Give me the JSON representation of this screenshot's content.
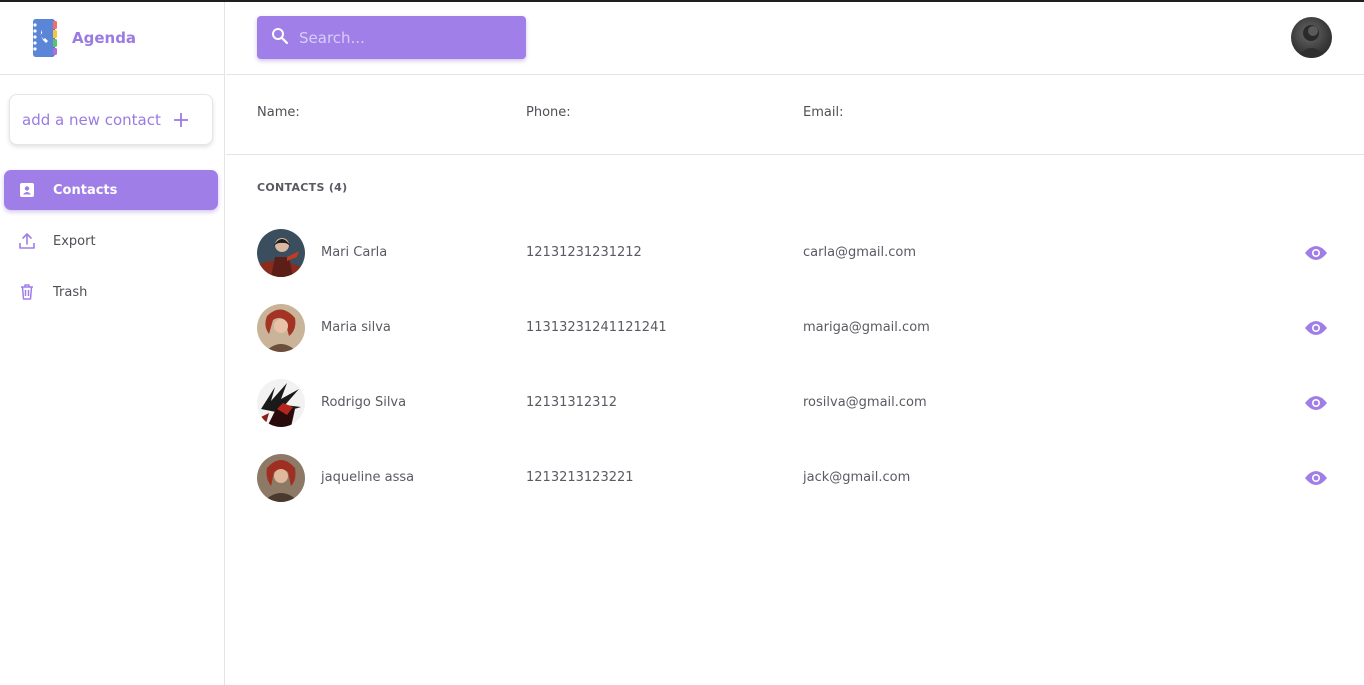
{
  "app": {
    "name": "Agenda",
    "logo_icon": "contact-book-icon"
  },
  "sidebar": {
    "add_button_label": "add a new contact",
    "add_button_icon": "plus-icon",
    "items": [
      {
        "label": "Contacts",
        "icon": "contact-card-icon",
        "active": true
      },
      {
        "label": "Export",
        "icon": "upload-icon",
        "active": false
      },
      {
        "label": "Trash",
        "icon": "trash-icon",
        "active": false
      }
    ]
  },
  "header": {
    "search_placeholder": "Search...",
    "search_icon": "search-icon",
    "user_avatar": "user-avatar"
  },
  "columns": {
    "name": "Name:",
    "phone": "Phone:",
    "email": "Email:"
  },
  "contacts_heading": "CONTACTS (4)",
  "contacts": [
    {
      "name": "Mari Carla",
      "phone": "12131231231212",
      "email": "carla@gmail.com"
    },
    {
      "name": "Maria silva",
      "phone": "11313231241121241",
      "email": "mariga@gmail.com"
    },
    {
      "name": "Rodrigo Silva",
      "phone": "12131312312",
      "email": "rosilva@gmail.com"
    },
    {
      "name": "jaqueline assa",
      "phone": "1213213123221",
      "email": "jack@gmail.com"
    }
  ],
  "colors": {
    "accent": "#9f7ee8",
    "text": "#5a5a62",
    "border": "#e4e4e8"
  }
}
